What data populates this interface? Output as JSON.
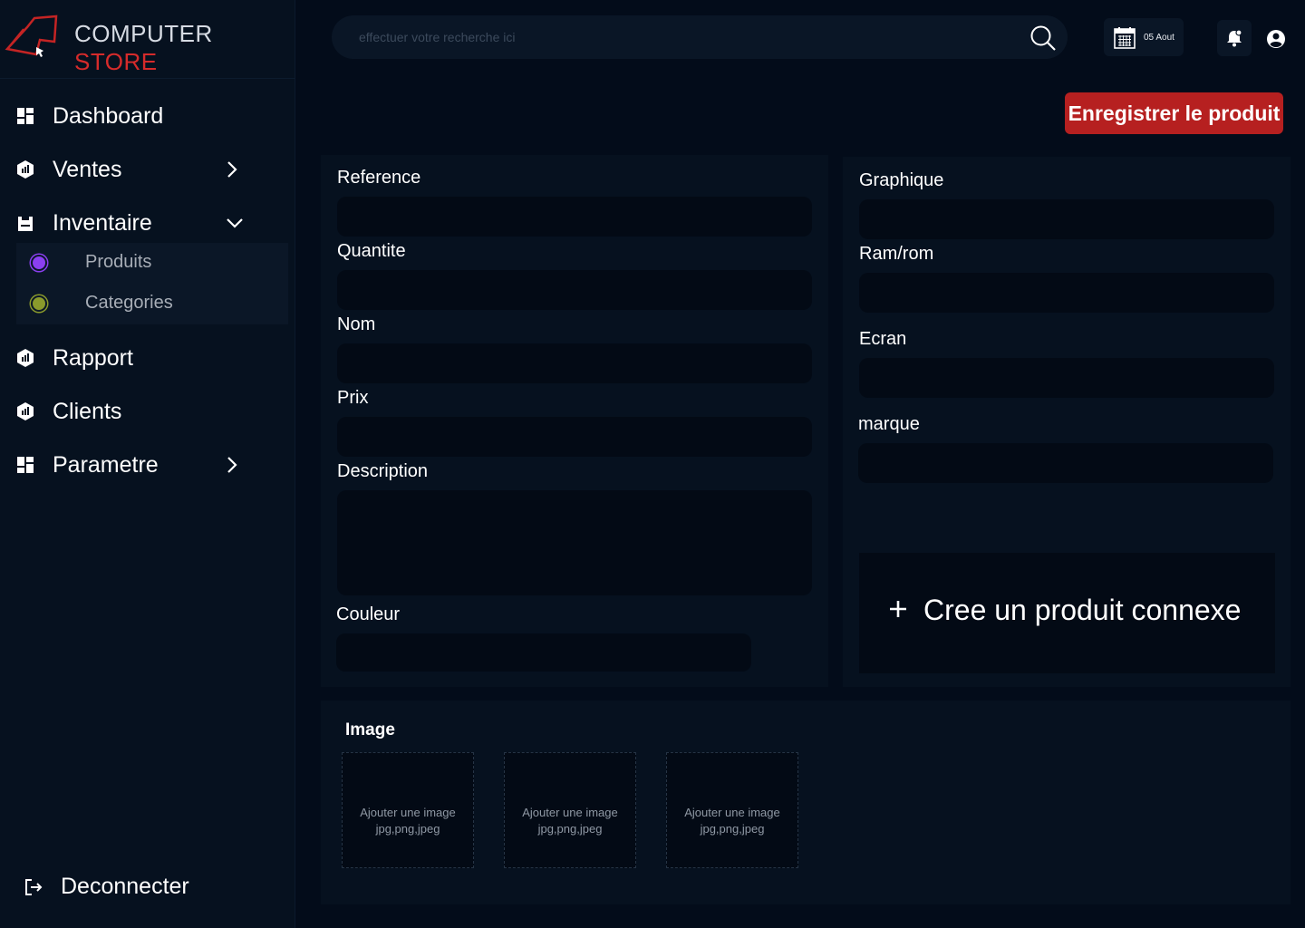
{
  "brand": {
    "name_part1": "COMPUTER",
    "name_part2": "STORE",
    "accent_color": "#d62b2b"
  },
  "search": {
    "placeholder": "effectuer votre recherche ici",
    "icon": "search-icon"
  },
  "header": {
    "date": "05 Aout",
    "notification_icon": "bell-icon",
    "user_icon": "user-circle-icon"
  },
  "sidebar": {
    "items": [
      {
        "label": "Dashboard",
        "icon": "grid-icon"
      },
      {
        "label": "Ventes",
        "icon": "chart-icon"
      },
      {
        "label": "Inventaire",
        "icon": "box-icon"
      },
      {
        "label": "Rapport",
        "icon": "chart-icon"
      },
      {
        "label": "Clients",
        "icon": "chart-icon"
      },
      {
        "label": "Parametre",
        "icon": "grid-icon"
      }
    ],
    "subitems": [
      {
        "label": "Produits",
        "color": "#8b3ff0"
      },
      {
        "label": "Categories",
        "color": "#8a9a2c"
      }
    ],
    "logout": "Deconnecter"
  },
  "actions": {
    "save_label": "Enregistrer le produit",
    "save_color": "#b62020"
  },
  "form_left": {
    "reference": "Reference",
    "quantite": "Quantite",
    "nom": "Nom",
    "prix": "Prix",
    "description": "Description",
    "couleur": "Couleur"
  },
  "form_right": {
    "graphique": "Graphique",
    "ramrom": "Ram/rom",
    "ecran": "Ecran",
    "marque": "marque",
    "connexe": "Cree un produit connexe"
  },
  "images": {
    "title": "Image",
    "slots": [
      {
        "line1": "Ajouter une image",
        "line2": "jpg,png,jpeg"
      },
      {
        "line1": "Ajouter une image",
        "line2": "jpg,png,jpeg"
      },
      {
        "line1": "Ajouter une image",
        "line2": "jpg,png,jpeg"
      }
    ]
  }
}
